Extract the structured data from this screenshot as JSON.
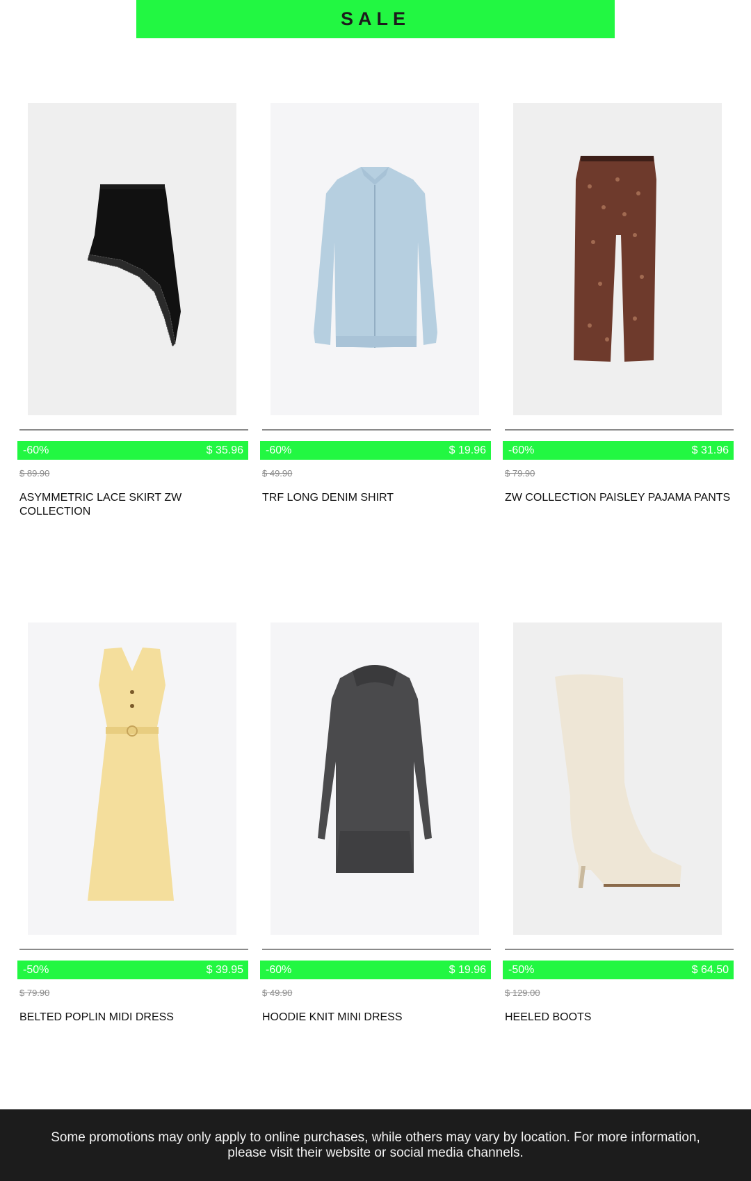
{
  "banner": {
    "label": "SALE",
    "color": "#22f742"
  },
  "products": [
    {
      "discount": "-60%",
      "price": "$ 35.96",
      "old_price": "$ 89.90",
      "name": "ASYMMETRIC LACE SKIRT ZW COLLECTION",
      "image": "black-lace-skirt"
    },
    {
      "discount": "-60%",
      "price": "$ 19.96",
      "old_price": "$ 49.90",
      "name": "TRF LONG DENIM SHIRT",
      "image": "light-denim-shirt"
    },
    {
      "discount": "-60%",
      "price": "$ 31.96",
      "old_price": "$ 79.90",
      "name": "ZW COLLECTION PAISLEY PAJAMA PANTS",
      "image": "paisley-pants"
    },
    {
      "discount": "-50%",
      "price": "$ 39.95",
      "old_price": "$ 79.90",
      "name": "BELTED POPLIN MIDI DRESS",
      "image": "yellow-midi-dress"
    },
    {
      "discount": "-60%",
      "price": "$ 19.96",
      "old_price": "$ 49.90",
      "name": "HOODIE KNIT MINI DRESS",
      "image": "grey-hoodie-dress"
    },
    {
      "discount": "-50%",
      "price": "$ 64.50",
      "old_price": "$ 129.00",
      "name": "HEELED BOOTS",
      "image": "cream-heeled-boot"
    }
  ],
  "footer": {
    "text": "Some promotions may only apply to online purchases, while others may vary by location. For more information, please visit their website or social media channels."
  }
}
